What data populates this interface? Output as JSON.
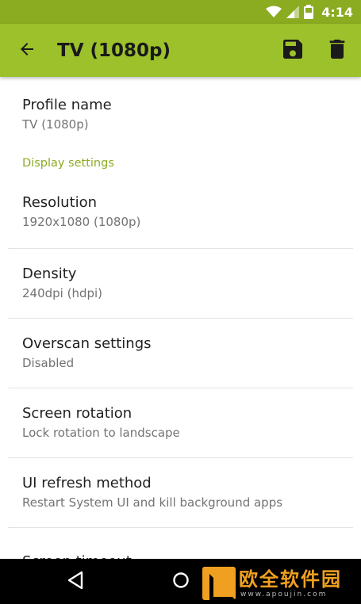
{
  "status_bar": {
    "time": "4:14"
  },
  "app_bar": {
    "title": "TV (1080p)"
  },
  "preferences": {
    "profile_name": {
      "title": "Profile name",
      "summary": "TV (1080p)"
    },
    "category": "Display settings",
    "items": [
      {
        "title": "Resolution",
        "summary": "1920x1080 (1080p)"
      },
      {
        "title": "Density",
        "summary": "240dpi (hdpi)"
      },
      {
        "title": "Overscan settings",
        "summary": "Disabled"
      },
      {
        "title": "Screen rotation",
        "summary": "Lock rotation to landscape"
      },
      {
        "title": "UI refresh method",
        "summary": "Restart System UI and kill background apps"
      },
      {
        "title": "Screen timeout",
        "summary": ""
      }
    ]
  },
  "watermark": {
    "name": "欧全软件园",
    "url": "www.apoujin.com"
  },
  "colors": {
    "status_bar": "#8bab20",
    "app_bar": "#9cc12b",
    "accent": "#8bab20"
  }
}
